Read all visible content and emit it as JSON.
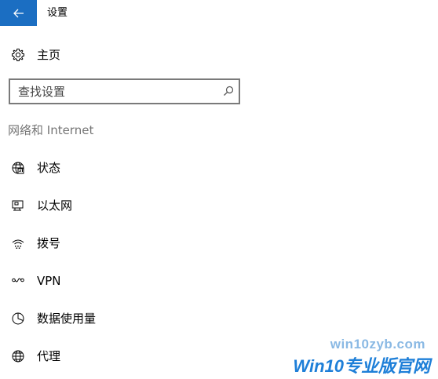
{
  "window": {
    "title": "设置",
    "back_icon": "back-arrow-icon",
    "accent_color": "#1b6ec2"
  },
  "home": {
    "label": "主页",
    "icon": "gear-icon"
  },
  "search": {
    "placeholder": "查找设置",
    "value": "",
    "icon": "search-icon"
  },
  "section": {
    "heading": "网络和 Internet"
  },
  "nav": {
    "items": [
      {
        "label": "状态",
        "icon": "globe-status-icon"
      },
      {
        "label": "以太网",
        "icon": "ethernet-icon"
      },
      {
        "label": "拨号",
        "icon": "dialup-icon"
      },
      {
        "label": "VPN",
        "icon": "vpn-icon"
      },
      {
        "label": "数据使用量",
        "icon": "data-usage-icon"
      },
      {
        "label": "代理",
        "icon": "globe-icon"
      }
    ]
  },
  "watermark": {
    "url": "win10zyb.com",
    "brand": "Win10专业版官网"
  }
}
